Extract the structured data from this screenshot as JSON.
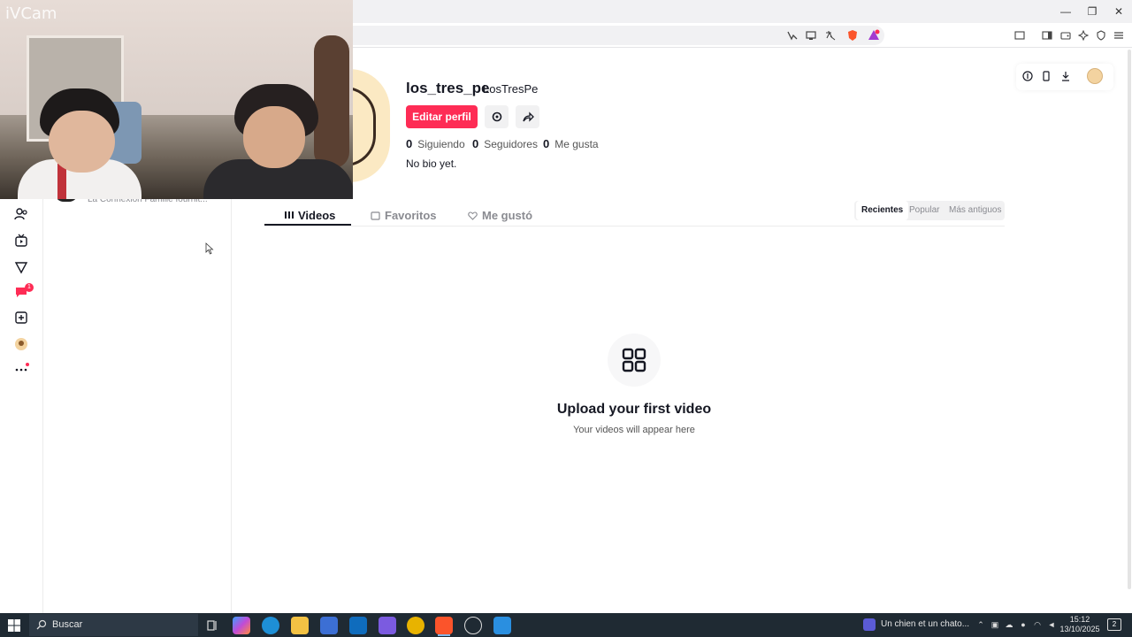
{
  "browser": {
    "url_fragment": "e",
    "window_controls": {
      "minimize": "—",
      "maximize": "❐",
      "close": "✕"
    }
  },
  "webcam": {
    "label": "iVCam"
  },
  "sidebar": {
    "sub_text": "La Connexion Famille fournit..."
  },
  "profile": {
    "username": "los_tres_pe",
    "nickname": "LosTresPe",
    "edit_button": "Editar perfil",
    "stats": [
      {
        "value": "0",
        "label": "Siguiendo"
      },
      {
        "value": "0",
        "label": "Seguidores"
      },
      {
        "value": "0",
        "label": "Me gusta"
      }
    ],
    "bio": "No bio yet."
  },
  "tabs": [
    {
      "label": "Videos",
      "icon": "grid-icon",
      "active": true
    },
    {
      "label": "Favoritos",
      "icon": "bookmark-icon",
      "active": false
    },
    {
      "label": "Me gustó",
      "icon": "heart-outline-icon",
      "active": false
    }
  ],
  "sort": {
    "options": [
      "Recientes",
      "Popular",
      "Más antiguos"
    ],
    "selected": "Recientes"
  },
  "empty_state": {
    "title": "Upload your first video",
    "subtitle": "Your videos will appear here"
  },
  "rail": {
    "messages_badge": "1"
  },
  "taskbar": {
    "search_placeholder": "Buscar",
    "media_title": "Un chien et un chato...",
    "time": "15:12",
    "date": "13/10/2025",
    "notifications": "2"
  },
  "colors": {
    "accent": "#fe2c55",
    "taskbar": "#1f2a33"
  }
}
